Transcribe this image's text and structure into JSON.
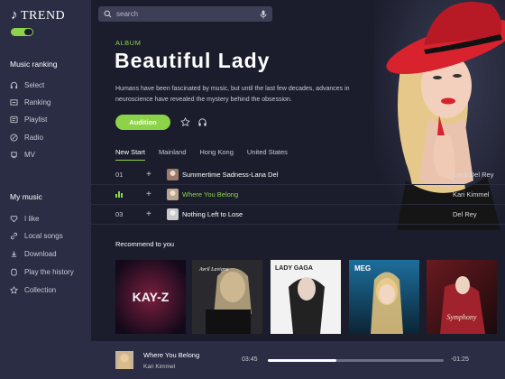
{
  "app": {
    "logo_text": "TREND"
  },
  "search": {
    "placeholder": "search"
  },
  "sidebar": {
    "ranking_heading": "Music ranking",
    "ranking_items": [
      {
        "label": "Select",
        "icon": "headphones-icon"
      },
      {
        "label": "Ranking",
        "icon": "ranking-icon"
      },
      {
        "label": "Playlist",
        "icon": "playlist-icon"
      },
      {
        "label": "Radio",
        "icon": "radio-icon"
      },
      {
        "label": "MV",
        "icon": "mv-icon"
      }
    ],
    "my_heading": "My music",
    "my_items": [
      {
        "label": "I like",
        "icon": "heart-icon"
      },
      {
        "label": "Local songs",
        "icon": "link-icon"
      },
      {
        "label": "Download",
        "icon": "download-icon"
      },
      {
        "label": "Play the history",
        "icon": "history-icon"
      },
      {
        "label": "Collection",
        "icon": "star-icon"
      }
    ]
  },
  "album": {
    "tag": "ALBUM",
    "title": "Beautiful Lady",
    "description": "Humans have been fascinated by music, but until the last few decades, advances in neuroscience have revealed the mystery behind the obsession.",
    "audition_label": "Audition"
  },
  "tabs": [
    "New Start",
    "Mainland",
    "Hong Kong",
    "United States"
  ],
  "songs": [
    {
      "num": "01",
      "title": "Summertime Sadness-Lana Del",
      "artist": "Lana Del Rey"
    },
    {
      "num": "",
      "title": "Where You Belong",
      "artist": "Kari Kimmel",
      "playing": true
    },
    {
      "num": "03",
      "title": "Nothing Left to Lose",
      "artist": "Del Rey"
    }
  ],
  "recommend": {
    "heading": "Recommend to you",
    "covers": [
      {
        "text": "KAY-Z"
      },
      {
        "text": "Avril Lavigne"
      },
      {
        "text": "LADY GAGA"
      },
      {
        "text": "MEG"
      },
      {
        "text": "Symphony"
      }
    ]
  },
  "player": {
    "title": "Where You Belong",
    "artist": "Kari Kimmel",
    "elapsed": "03:45",
    "remaining": "-01:25",
    "progress": 0.39
  },
  "colors": {
    "accent": "#8cd34a",
    "bg": "#1b1d2c",
    "sidebar": "#2a2d44",
    "portrait_hat": "#d8222e"
  }
}
